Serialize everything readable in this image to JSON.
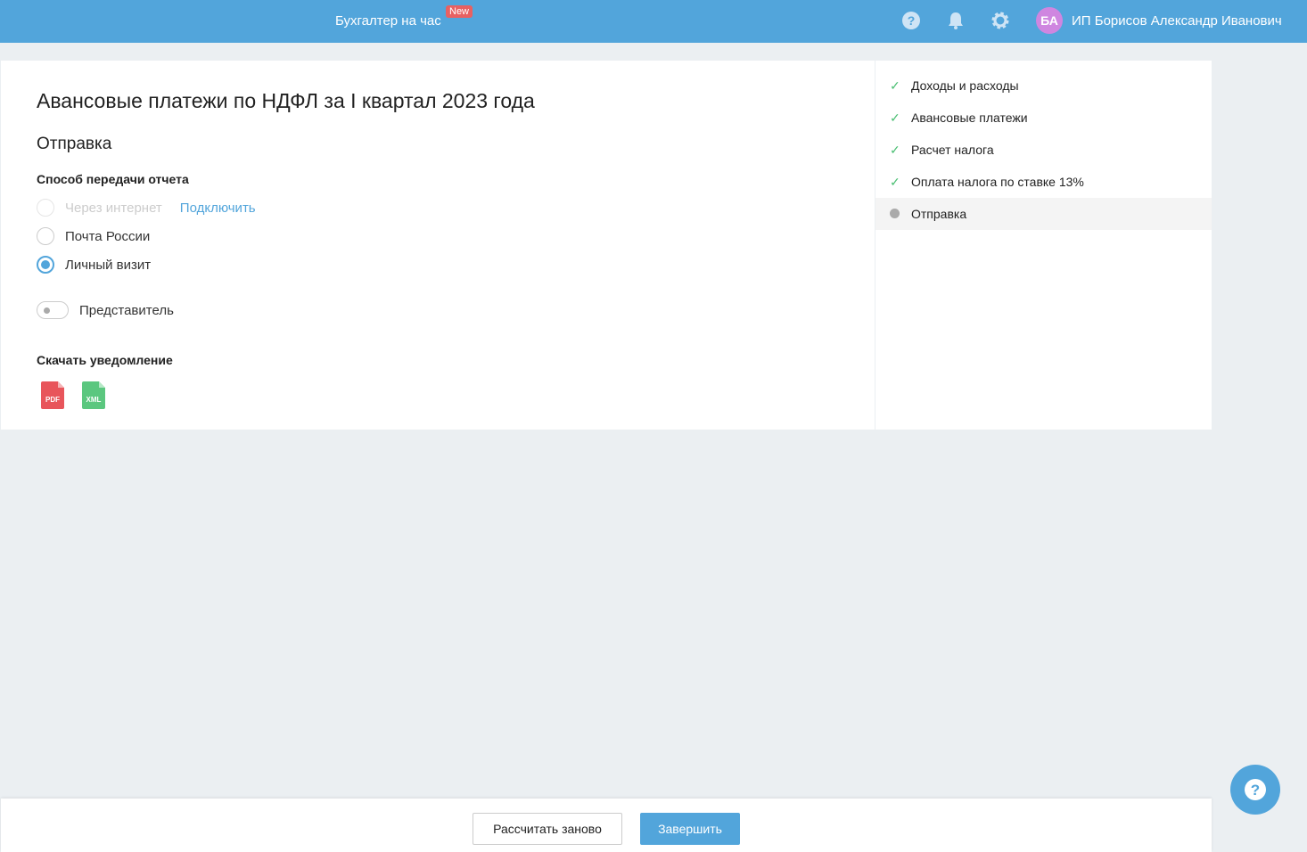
{
  "header": {
    "brand": "Бухгалтер на час",
    "badge": "New",
    "avatar": "БА",
    "user": "ИП Борисов Александр Иванович"
  },
  "main": {
    "title": "Авансовые платежи по НДФЛ за I квартал 2023 года",
    "section": "Отправка",
    "method_label": "Способ передачи отчета",
    "options": [
      {
        "label": "Через интернет",
        "disabled": true,
        "checked": false
      },
      {
        "label": "Почта России",
        "checked": false
      },
      {
        "label": "Личный визит",
        "checked": true
      }
    ],
    "connect_link": "Подключить",
    "representative": "Представитель",
    "download_label": "Скачать уведомление",
    "files": [
      "PDF",
      "XML"
    ]
  },
  "steps": [
    {
      "label": "Доходы и расходы",
      "done": true
    },
    {
      "label": "Авансовые платежи",
      "done": true
    },
    {
      "label": "Расчет налога",
      "done": true
    },
    {
      "label": "Оплата налога по ставке 13%",
      "done": true
    },
    {
      "label": "Отправка",
      "done": false
    }
  ],
  "footer": {
    "recalc": "Рассчитать заново",
    "finish": "Завершить"
  }
}
